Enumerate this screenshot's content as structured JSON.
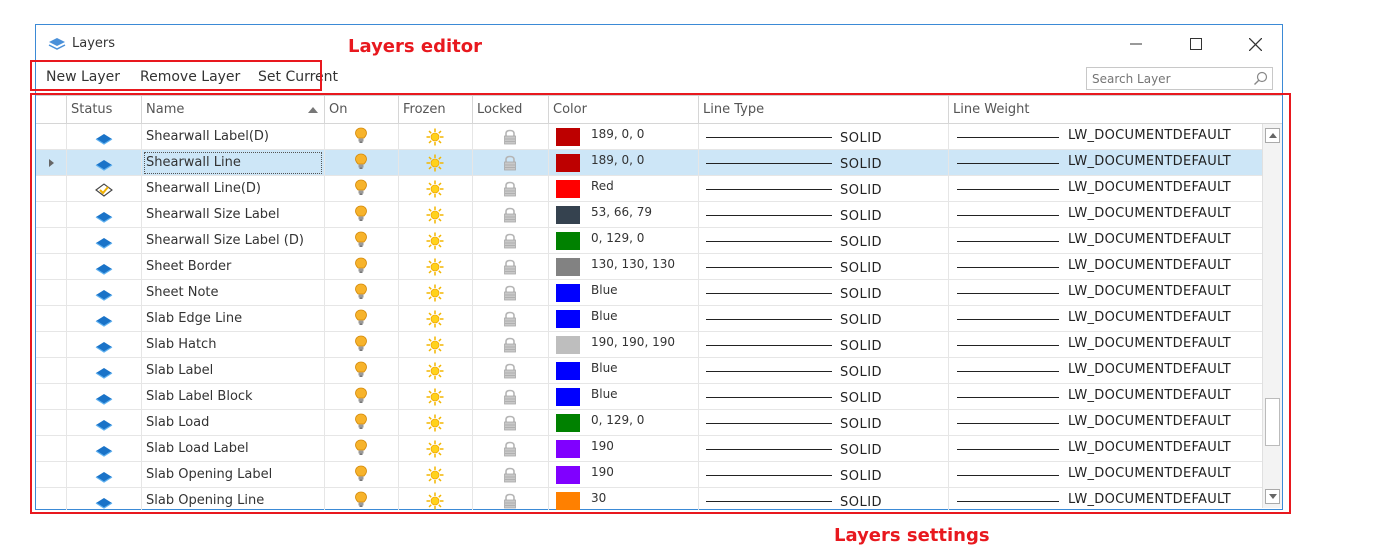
{
  "window": {
    "title": "Layers"
  },
  "toolbar": {
    "new_layer": "New Layer",
    "remove_layer": "Remove Layer",
    "set_current": "Set Current"
  },
  "search": {
    "placeholder": "Search Layer"
  },
  "columns": {
    "status": "Status",
    "name": "Name",
    "on": "On",
    "frozen": "Frozen",
    "locked": "Locked",
    "color": "Color",
    "line_type": "Line Type",
    "line_weight": "Line Weight"
  },
  "annotations": {
    "editor": "Layers editor",
    "settings": "Layers settings"
  },
  "rows": [
    {
      "name": "Shearwall Label(D)",
      "status": "layer",
      "color_hex": "#bd0000",
      "color_text": "189, 0, 0",
      "line_type": "SOLID",
      "line_weight": "LW_DOCUMENTDEFAULT"
    },
    {
      "name": "Shearwall Line",
      "status": "layer",
      "color_hex": "#bd0000",
      "color_text": "189, 0, 0",
      "line_type": "SOLID",
      "line_weight": "LW_DOCUMENTDEFAULT",
      "selected": true
    },
    {
      "name": "Shearwall Line(D)",
      "status": "current",
      "color_hex": "#ff0000",
      "color_text": "Red",
      "line_type": "SOLID",
      "line_weight": "LW_DOCUMENTDEFAULT"
    },
    {
      "name": "Shearwall Size Label",
      "status": "layer",
      "color_hex": "#35424f",
      "color_text": "53, 66, 79",
      "line_type": "SOLID",
      "line_weight": "LW_DOCUMENTDEFAULT"
    },
    {
      "name": "Shearwall Size Label (D)",
      "status": "layer",
      "color_hex": "#008100",
      "color_text": "0, 129, 0",
      "line_type": "SOLID",
      "line_weight": "LW_DOCUMENTDEFAULT"
    },
    {
      "name": "Sheet Border",
      "status": "layer",
      "color_hex": "#828282",
      "color_text": "130, 130, 130",
      "line_type": "SOLID",
      "line_weight": "LW_DOCUMENTDEFAULT"
    },
    {
      "name": "Sheet Note",
      "status": "layer",
      "color_hex": "#0000ff",
      "color_text": "Blue",
      "line_type": "SOLID",
      "line_weight": "LW_DOCUMENTDEFAULT"
    },
    {
      "name": "Slab Edge Line",
      "status": "layer",
      "color_hex": "#0000ff",
      "color_text": "Blue",
      "line_type": "SOLID",
      "line_weight": "LW_DOCUMENTDEFAULT"
    },
    {
      "name": "Slab Hatch",
      "status": "layer",
      "color_hex": "#bebebe",
      "color_text": "190, 190, 190",
      "line_type": "SOLID",
      "line_weight": "LW_DOCUMENTDEFAULT"
    },
    {
      "name": "Slab Label",
      "status": "layer",
      "color_hex": "#0000ff",
      "color_text": "Blue",
      "line_type": "SOLID",
      "line_weight": "LW_DOCUMENTDEFAULT"
    },
    {
      "name": "Slab Label Block",
      "status": "layer",
      "color_hex": "#0000ff",
      "color_text": "Blue",
      "line_type": "SOLID",
      "line_weight": "LW_DOCUMENTDEFAULT"
    },
    {
      "name": "Slab Load",
      "status": "layer",
      "color_hex": "#008100",
      "color_text": "0, 129, 0",
      "line_type": "SOLID",
      "line_weight": "LW_DOCUMENTDEFAULT"
    },
    {
      "name": "Slab Load Label",
      "status": "layer",
      "color_hex": "#8000ff",
      "color_text": "190",
      "line_type": "SOLID",
      "line_weight": "LW_DOCUMENTDEFAULT"
    },
    {
      "name": "Slab Opening Label",
      "status": "layer",
      "color_hex": "#8000ff",
      "color_text": "190",
      "line_type": "SOLID",
      "line_weight": "LW_DOCUMENTDEFAULT"
    },
    {
      "name": "Slab Opening Line",
      "status": "layer",
      "color_hex": "#ff8000",
      "color_text": "30",
      "line_type": "SOLID",
      "line_weight": "LW_DOCUMENTDEFAULT"
    }
  ]
}
